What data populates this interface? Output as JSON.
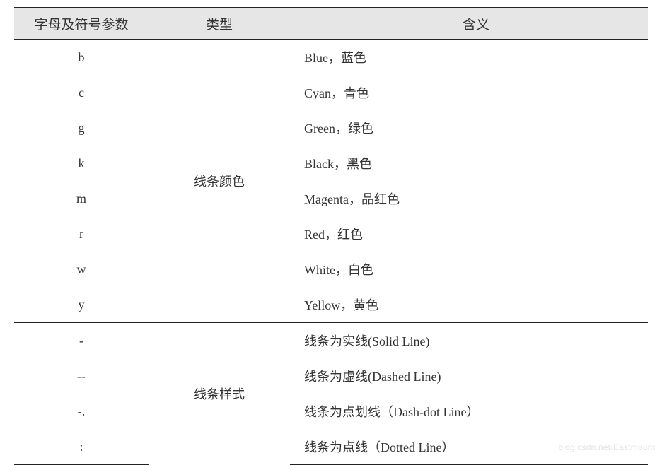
{
  "headers": {
    "col1": "字母及符号参数",
    "col2": "类型",
    "col3": "含义"
  },
  "groups": [
    {
      "type_label": "线条颜色",
      "rows": [
        {
          "code": "b",
          "meaning": "Blue，蓝色"
        },
        {
          "code": "c",
          "meaning": "Cyan，青色"
        },
        {
          "code": "g",
          "meaning": "Green，绿色"
        },
        {
          "code": "k",
          "meaning": "Black，黑色"
        },
        {
          "code": "m",
          "meaning": "Magenta，品红色"
        },
        {
          "code": "r",
          "meaning": "Red，红色"
        },
        {
          "code": "w",
          "meaning": "White，白色"
        },
        {
          "code": "y",
          "meaning": "Yellow，黄色"
        }
      ]
    },
    {
      "type_label": "线条样式",
      "rows": [
        {
          "code": "-",
          "meaning": "线条为实线(Solid Line)"
        },
        {
          "code": "--",
          "meaning": "线条为虚线(Dashed Line)"
        },
        {
          "code": "-.",
          "meaning": "线条为点划线（Dash-dot Line）"
        },
        {
          "code": ":",
          "meaning": "线条为点线（Dotted Line）"
        }
      ]
    }
  ],
  "watermark": "blog.csdn.net/Eastmount"
}
